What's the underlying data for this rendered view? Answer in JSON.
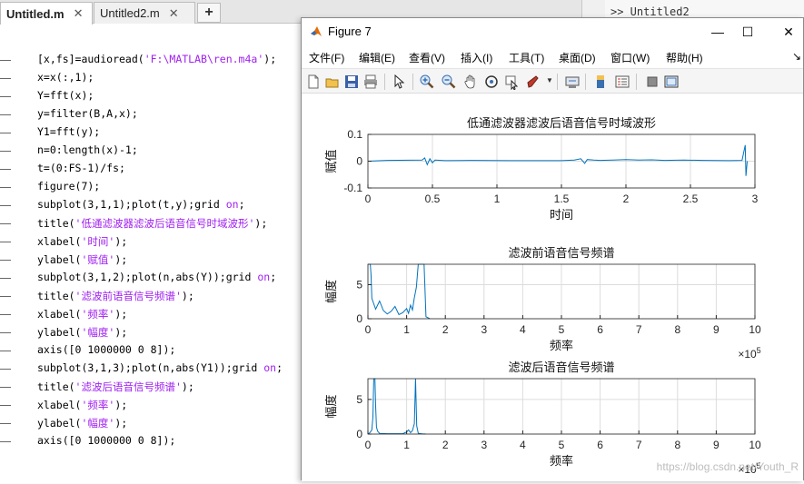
{
  "editor": {
    "tabs": [
      {
        "label": "Untitled.m",
        "close": "✕",
        "active": true
      },
      {
        "label": "Untitled2.m",
        "close": "✕",
        "active": false
      }
    ],
    "add_tab": "+",
    "code_lines": [
      "[x,fs]=audioread('F:\\MATLAB\\ren.m4a');",
      "x=x(:,1);",
      "Y=fft(x);",
      "y=filter(B,A,x);",
      "Y1=fft(y);",
      "n=0:length(x)-1;",
      "t=(0:FS-1)/fs;",
      "figure(7);",
      "subplot(3,1,1);plot(t,y);grid on;",
      "title('低通滤波器滤波后语音信号时域波形');",
      "xlabel('时间');",
      "ylabel('赋值');",
      "subplot(3,1,2);plot(n,abs(Y));grid on;",
      "title('滤波前语音信号频谱');",
      "xlabel('频率');",
      "ylabel('幅度');",
      "axis([0 1000000 0 8]);",
      "subplot(3,1,3);plot(n,abs(Y1));grid on;",
      "title('滤波后语音信号频谱');",
      "xlabel('频率');",
      "ylabel('幅度');",
      "axis([0 1000000 0 8]);"
    ]
  },
  "command_window": {
    "header": ">> Untitled2"
  },
  "figure": {
    "title": "Figure 7",
    "controls": {
      "minimize": "—",
      "maximize": "☐",
      "close": "✕"
    },
    "menus": [
      "文件(F)",
      "编辑(E)",
      "查看(V)",
      "插入(I)",
      "工具(T)",
      "桌面(D)",
      "窗口(W)",
      "帮助(H)"
    ],
    "menu_arrow": "↘"
  },
  "colors": {
    "line": "#0072bd",
    "grid": "#dcdcdc",
    "axis": "#262626"
  },
  "chart_data": [
    {
      "type": "line",
      "title": "低通滤波器滤波后语音信号时域波形",
      "xlabel": "时间",
      "ylabel": "赋值",
      "xlim": [
        0,
        3
      ],
      "ylim": [
        -0.1,
        0.1
      ],
      "xticks": [
        "0",
        "0.5",
        "1",
        "1.5",
        "2",
        "2.5",
        "3"
      ],
      "yticks": [
        "-0.1",
        "0",
        "0.1"
      ],
      "grid": true,
      "series": [
        {
          "x": [
            0,
            0.15,
            0.42,
            0.44,
            0.46,
            0.48,
            0.5,
            0.52,
            0.6,
            0.8,
            1.1,
            1.5,
            1.6,
            1.65,
            1.68,
            1.7,
            1.75,
            1.8,
            1.9,
            1.95,
            2.0,
            2.1,
            2.2,
            2.3,
            2.45,
            2.6,
            2.8,
            2.9,
            2.925,
            2.93,
            2.94
          ],
          "y": [
            0,
            0.003,
            0.004,
            0.012,
            -0.013,
            0.009,
            -0.006,
            0.004,
            0.002,
            0.003,
            0.002,
            0.002,
            0.004,
            0.009,
            -0.008,
            0.006,
            0.004,
            0.003,
            0.004,
            0.005,
            0.006,
            0.004,
            0.005,
            0.003,
            0.004,
            0.003,
            0.002,
            0.003,
            0.06,
            -0.055,
            0
          ]
        }
      ]
    },
    {
      "type": "line",
      "title": "滤波前语音信号频谱",
      "xlabel": "频率",
      "ylabel": "幅度",
      "xlim": [
        0,
        10
      ],
      "x_exponent": "×10^5",
      "ylim": [
        0,
        8
      ],
      "xticks": [
        "0",
        "1",
        "2",
        "3",
        "4",
        "5",
        "6",
        "7",
        "8",
        "9",
        "10"
      ],
      "yticks": [
        "0",
        "5"
      ],
      "grid": true,
      "series": [
        {
          "x": [
            0,
            0.02,
            0.04,
            0.06,
            0.08,
            0.1,
            0.15,
            0.2,
            0.3,
            0.4,
            0.5,
            0.6,
            0.7,
            0.8,
            0.9,
            1.0,
            1.05,
            1.1,
            1.15,
            1.2,
            1.25,
            1.3,
            1.33,
            1.36,
            1.4,
            1.45,
            1.5,
            1.6
          ],
          "y": [
            8,
            8,
            8,
            8,
            6.5,
            3.0,
            2.2,
            1.4,
            2.6,
            1.2,
            0.7,
            1.1,
            1.8,
            0.6,
            0.9,
            1.5,
            0.8,
            2.0,
            1.3,
            3.1,
            4.6,
            8,
            8,
            8,
            8,
            8,
            0.3,
            0
          ]
        }
      ]
    },
    {
      "type": "line",
      "title": "滤波后语音信号频谱",
      "xlabel": "频率",
      "ylabel": "幅度",
      "xlim": [
        0,
        10
      ],
      "x_exponent": "×10^5",
      "ylim": [
        0,
        8
      ],
      "xticks": [
        "0",
        "1",
        "2",
        "3",
        "4",
        "5",
        "6",
        "7",
        "8",
        "9",
        "10"
      ],
      "yticks": [
        "0",
        "5"
      ],
      "grid": true,
      "series": [
        {
          "x": [
            0,
            0.05,
            0.1,
            0.13,
            0.15,
            0.18,
            0.2,
            0.22,
            0.25,
            0.3,
            0.5,
            0.7,
            0.9,
            1.0,
            1.05,
            1.1,
            1.15,
            1.2,
            1.23,
            1.26,
            1.3,
            1.4,
            1.5
          ],
          "y": [
            0,
            0.2,
            0.6,
            2.5,
            8,
            8,
            4.0,
            1.0,
            0.4,
            0.1,
            0.05,
            0.05,
            0.05,
            0.3,
            0.6,
            0.2,
            0.5,
            1.5,
            8,
            1.2,
            0.1,
            0.02,
            0
          ]
        }
      ]
    }
  ],
  "watermark": "https://blog.csdn.net/Youth_R"
}
